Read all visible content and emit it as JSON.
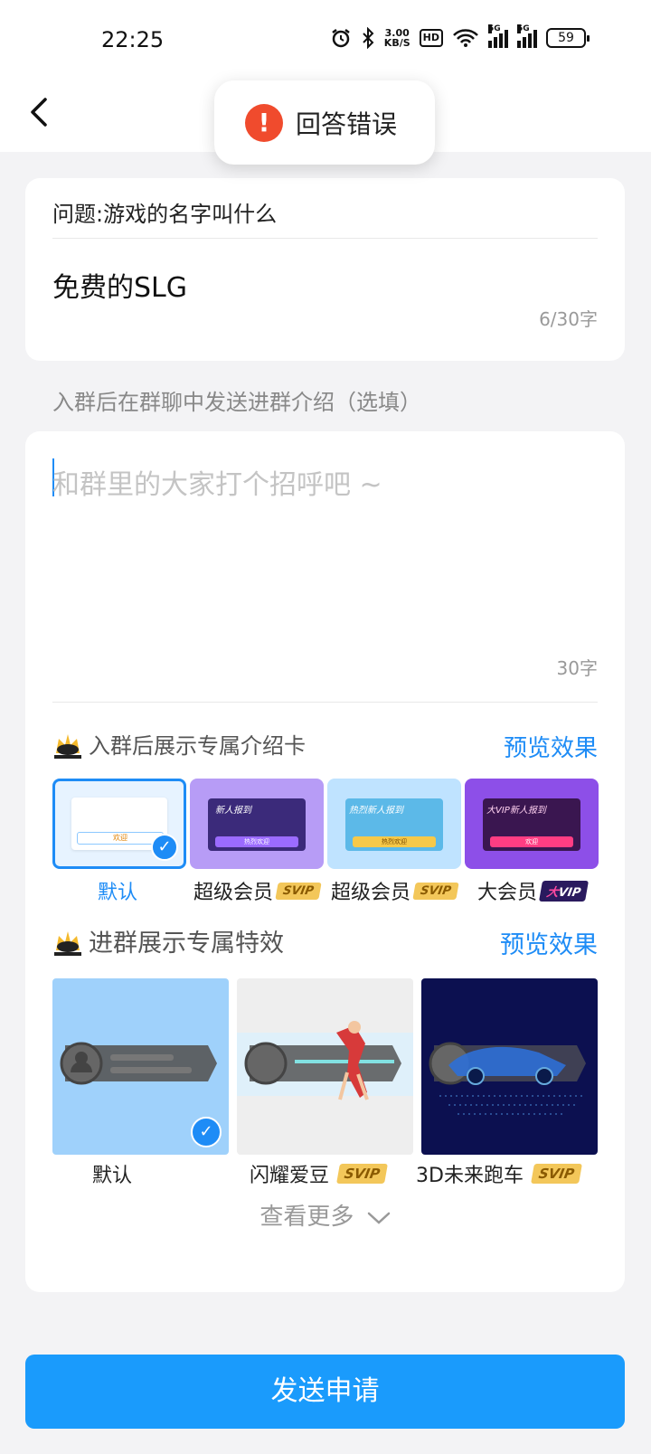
{
  "status_bar": {
    "time": "22:25",
    "net_speed_value": "3.00",
    "net_speed_unit": "KB/S",
    "hd_label": "HD",
    "signal1_label": "5G",
    "signal2_label": "5G",
    "battery": "59"
  },
  "toast": {
    "icon": "warning-icon",
    "message": "回答错误"
  },
  "question_card": {
    "question": "问题:游戏的名字叫什么",
    "answer": "免费的SLG",
    "char_count": "6/30字"
  },
  "intro_section_label": "入群后在群聊中发送进群介绍（选填）",
  "intro_input": {
    "placeholder": "和群里的大家打个招呼吧 ~",
    "limit": "30字"
  },
  "intro_card_section": {
    "title": "入群后展示专属介绍卡",
    "preview_label": "预览效果",
    "items": [
      {
        "label": "默认",
        "selected": true,
        "thumb_text": "欢迎"
      },
      {
        "label": "超级会员",
        "badge": "SVIP",
        "thumb_title": "新人报到",
        "thumb_button": "热烈欢迎"
      },
      {
        "label": "超级会员",
        "badge": "SVIP",
        "thumb_title": "热烈新人报到",
        "thumb_button": "热烈欢迎"
      },
      {
        "label": "大会员",
        "badge_prefix": "大",
        "badge": "VIP",
        "thumb_title": "大VIP新人报到",
        "thumb_button": "欢迎"
      }
    ]
  },
  "effect_section": {
    "title": "进群展示专属特效",
    "preview_label": "预览效果",
    "items": [
      {
        "label": "默认",
        "selected": true
      },
      {
        "label": "闪耀爱豆",
        "badge": "SVIP"
      },
      {
        "label": "3D未来跑车",
        "badge": "SVIP"
      }
    ],
    "more_label": "查看更多"
  },
  "submit_button": "发送申请",
  "colors": {
    "accent": "#1e8cf6",
    "submit": "#1a9bfc",
    "warning": "#f04b2d",
    "svip_badge": "#f3c75a"
  }
}
